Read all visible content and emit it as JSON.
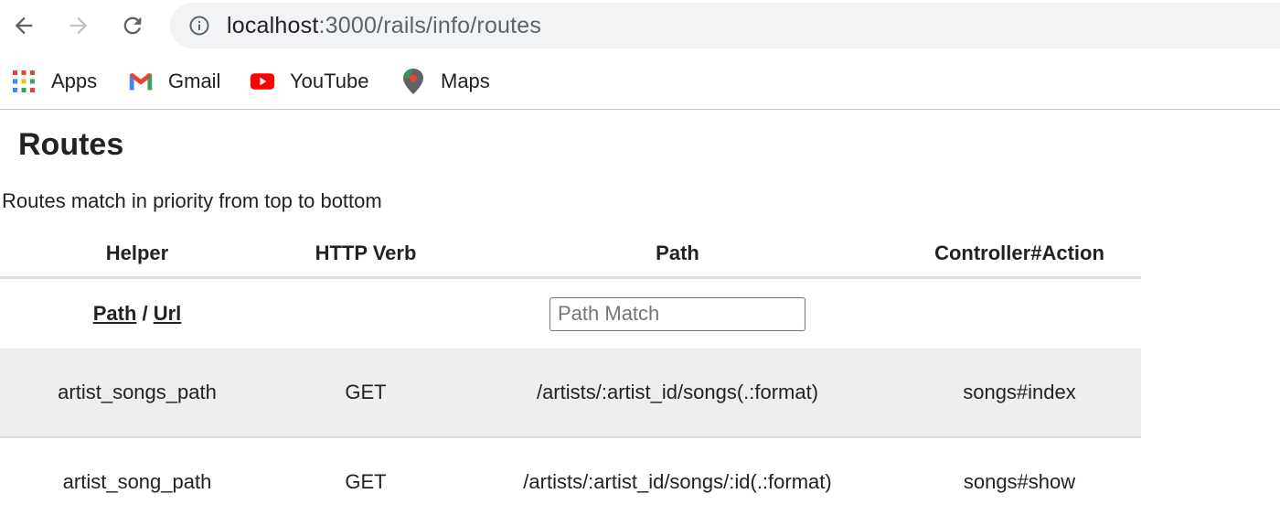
{
  "browser": {
    "url_host": "localhost",
    "url_rest": ":3000/rails/info/routes",
    "bookmarks": [
      {
        "label": "Apps",
        "icon": "apps-grid-icon"
      },
      {
        "label": "Gmail",
        "icon": "gmail-icon"
      },
      {
        "label": "YouTube",
        "icon": "youtube-icon"
      },
      {
        "label": "Maps",
        "icon": "maps-pin-icon"
      }
    ]
  },
  "page": {
    "title": "Routes",
    "subtitle": "Routes match in priority from top to bottom"
  },
  "table": {
    "headers": [
      "Helper",
      "HTTP Verb",
      "Path",
      "Controller#Action"
    ],
    "filter": {
      "path_link": "Path",
      "separator": " / ",
      "url_link": "Url",
      "search_placeholder": "Path Match"
    },
    "rows": [
      {
        "helper": "artist_songs_path",
        "verb": "GET",
        "path": "/artists/:artist_id/songs(.:format)",
        "action": "songs#index"
      },
      {
        "helper": "artist_song_path",
        "verb": "GET",
        "path": "/artists/:artist_id/songs/:id(.:format)",
        "action": "songs#show"
      }
    ]
  },
  "colors": {
    "row_alt": "#eeeeee",
    "omnibox_bg": "#f1f3f4",
    "gmail_red": "#ea4335",
    "youtube_red": "#ff0000"
  }
}
